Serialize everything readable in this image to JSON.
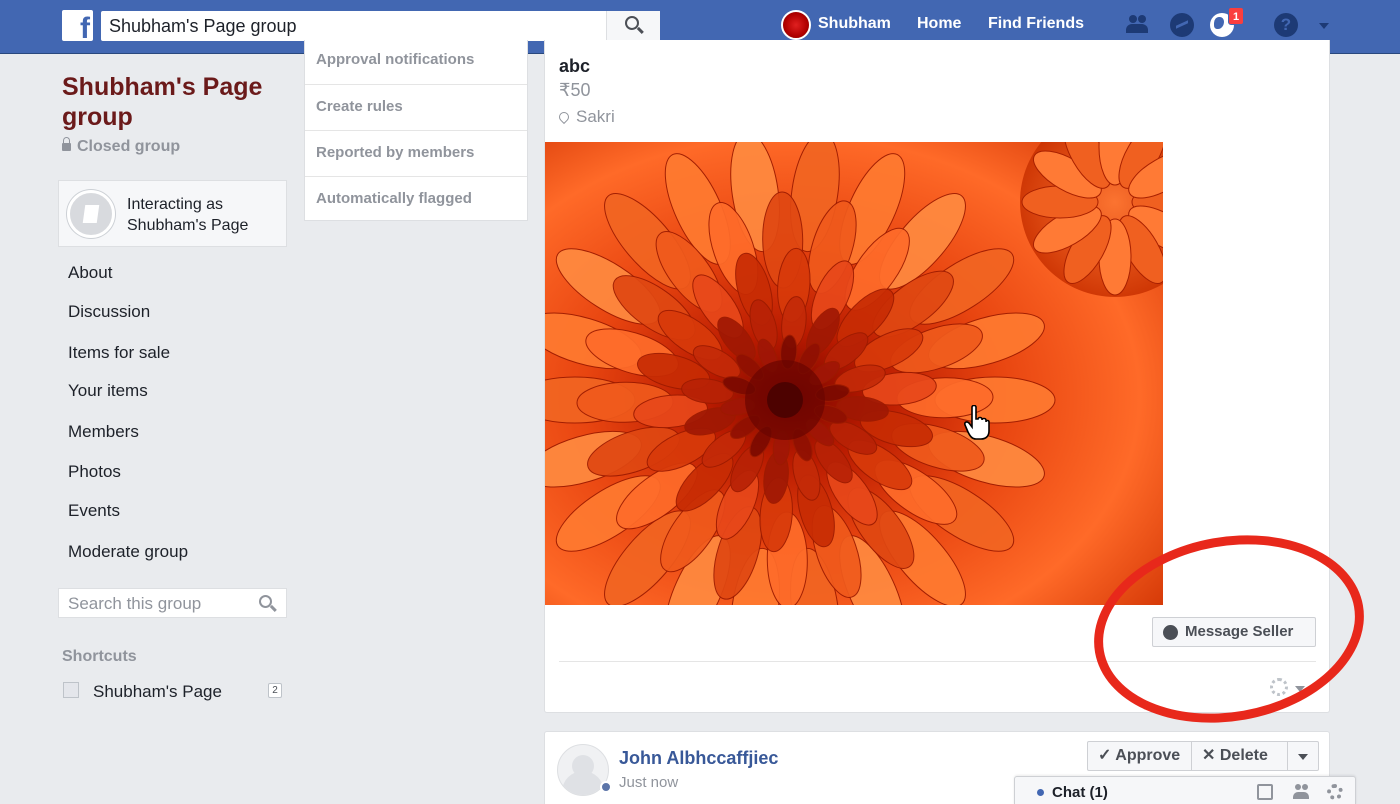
{
  "topbar": {
    "logo_letter": "f",
    "search_value": "Shubham's Page group",
    "user_name": "Shubham",
    "home": "Home",
    "find_friends": "Find Friends",
    "notification_count": "1",
    "icons": [
      "facebook-logo",
      "search-icon",
      "friend-requests-icon",
      "messages-icon",
      "notifications-globe-icon",
      "help-icon",
      "chevron-down-icon"
    ],
    "bar_color": "#4267b2"
  },
  "group": {
    "title": "Shubham's Page group",
    "privacy": "Closed group",
    "interacting_as": "Interacting as Shubham's Page"
  },
  "sidebar": {
    "items": [
      {
        "label": "About"
      },
      {
        "label": "Discussion"
      },
      {
        "label": "Items for sale"
      },
      {
        "label": "Your items"
      },
      {
        "label": "Members"
      },
      {
        "label": "Photos"
      },
      {
        "label": "Events"
      },
      {
        "label": "Moderate group"
      }
    ],
    "search_placeholder": "Search this group",
    "shortcuts_heading": "Shortcuts",
    "shortcut": {
      "label": "Shubham's Page",
      "count": "2"
    }
  },
  "moderation_menu": {
    "items": [
      {
        "label": "Approval notifications"
      },
      {
        "label": "Create rules"
      },
      {
        "label": "Reported by members"
      },
      {
        "label": "Automatically flagged"
      }
    ]
  },
  "post": {
    "title": "abc",
    "price": "₹50",
    "location": "Sakri",
    "photo_subject": "orange chrysanthemum flower",
    "message_seller": "Message Seller",
    "highlight_color": "#e8281b"
  },
  "pending_post": {
    "author": "John Albhccaffjiec",
    "time": "Just now",
    "approve": "Approve",
    "delete": "Delete"
  },
  "chat": {
    "label": "Chat (1)"
  }
}
